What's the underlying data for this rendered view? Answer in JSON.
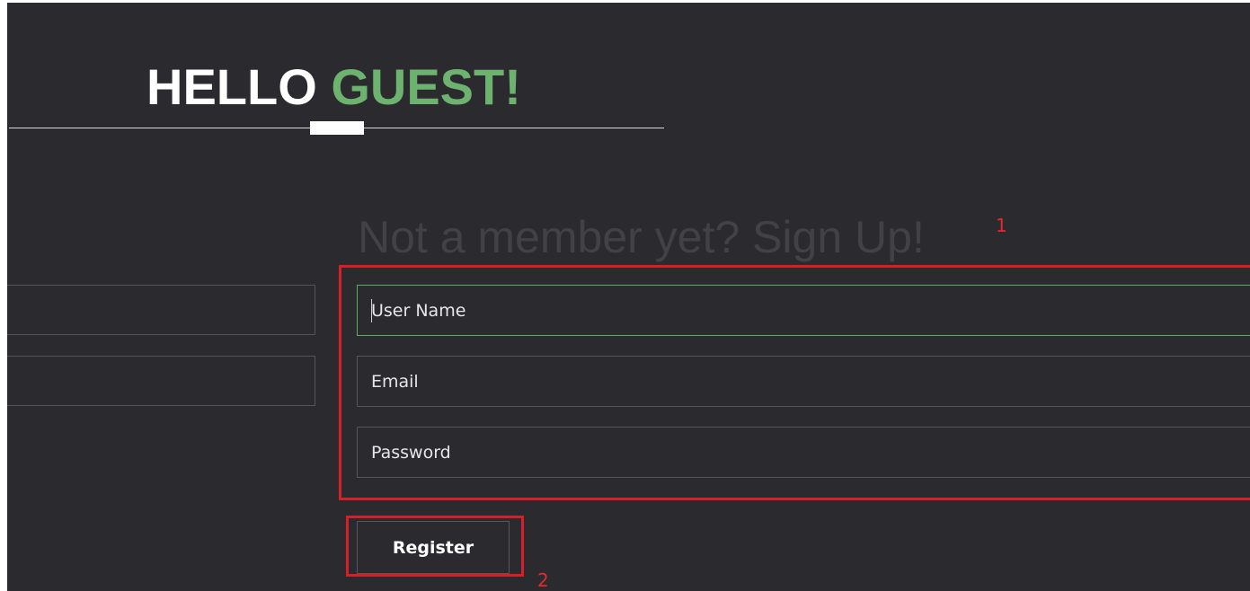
{
  "header": {
    "greeting_word": "HELLO",
    "greeting_name": "GUEST!"
  },
  "signup": {
    "heading": "Not a member yet? Sign Up!",
    "username_placeholder": "User Name",
    "email_placeholder": "Email",
    "password_placeholder": "Password",
    "register_label": "Register"
  },
  "annotations": {
    "fields_box_number": "1",
    "register_box_number": "2"
  },
  "colors": {
    "background": "#2b2b2f",
    "accent_green": "#6db36f",
    "annotation_red": "#d62027"
  }
}
